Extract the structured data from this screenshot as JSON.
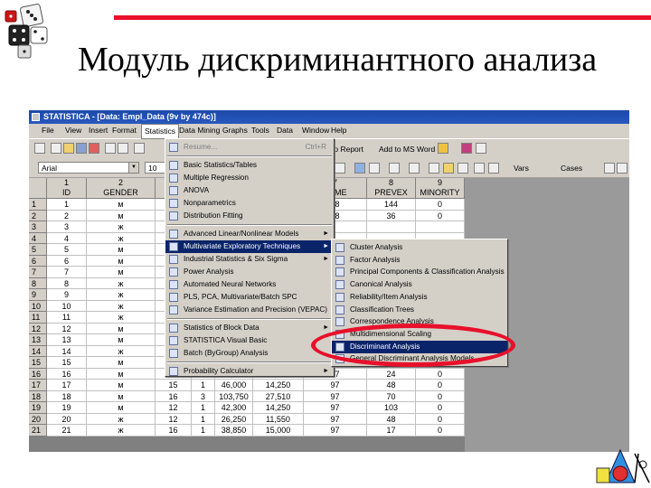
{
  "slide": {
    "title": "Модуль дискриминантного анализа",
    "accent_color": "#e8102a"
  },
  "window": {
    "title": "STATISTICA - [Data: Empl_Data (9v by 474c)]"
  },
  "menubar": {
    "items": [
      "File",
      "View",
      "Insert",
      "Format",
      "Statistics",
      "Data Mining",
      "Graphs",
      "Tools",
      "Data",
      "Window",
      "Help"
    ],
    "active": "Statistics"
  },
  "toolbar": {
    "add_to_report": "to Report",
    "add_to_ms_word": "Add to MS Word",
    "font_name": "Arial",
    "font_size": "10",
    "vars_label": "Vars",
    "cases_label": "Cases"
  },
  "grid": {
    "columns": [
      {
        "num": "1",
        "name": "ID"
      },
      {
        "num": "2",
        "name": "GENDER"
      },
      {
        "num": "",
        "name": "E"
      },
      {
        "num": "",
        "name": ""
      },
      {
        "num": "",
        "name": ""
      },
      {
        "num": "",
        "name": ""
      },
      {
        "num": "7",
        "name": "JTIME"
      },
      {
        "num": "8",
        "name": "PREVEX"
      },
      {
        "num": "9",
        "name": "MINORITY"
      }
    ],
    "rows": [
      {
        "n": "1",
        "cells": [
          "1",
          "м",
          "",
          "",
          "",
          "",
          "98",
          "144",
          "0"
        ]
      },
      {
        "n": "2",
        "cells": [
          "2",
          "м",
          "",
          "",
          "",
          "",
          "98",
          "36",
          "0"
        ]
      },
      {
        "n": "3",
        "cells": [
          "3",
          "ж",
          "",
          "",
          "",
          "",
          "",
          "",
          ""
        ]
      },
      {
        "n": "4",
        "cells": [
          "4",
          "ж",
          "",
          "",
          "",
          "",
          "",
          "",
          ""
        ]
      },
      {
        "n": "5",
        "cells": [
          "5",
          "м",
          "",
          "",
          "",
          "",
          "",
          "",
          ""
        ]
      },
      {
        "n": "6",
        "cells": [
          "6",
          "м",
          "",
          "",
          "",
          "",
          "",
          "",
          ""
        ]
      },
      {
        "n": "7",
        "cells": [
          "7",
          "м",
          "",
          "",
          "",
          "",
          "",
          "",
          ""
        ]
      },
      {
        "n": "8",
        "cells": [
          "8",
          "ж",
          "",
          "",
          "",
          "",
          "",
          "",
          ""
        ]
      },
      {
        "n": "9",
        "cells": [
          "9",
          "ж",
          "",
          "",
          "",
          "",
          "",
          "",
          ""
        ]
      },
      {
        "n": "10",
        "cells": [
          "10",
          "ж",
          "",
          "",
          "",
          "",
          "",
          "",
          ""
        ]
      },
      {
        "n": "11",
        "cells": [
          "11",
          "ж",
          "",
          "",
          "",
          "",
          "",
          "",
          ""
        ]
      },
      {
        "n": "12",
        "cells": [
          "12",
          "м",
          "",
          "",
          "",
          "",
          "",
          "",
          ""
        ]
      },
      {
        "n": "13",
        "cells": [
          "13",
          "м",
          "",
          "",
          "",
          "",
          "",
          "",
          ""
        ]
      },
      {
        "n": "14",
        "cells": [
          "14",
          "ж",
          "",
          "",
          "",
          "",
          "",
          "",
          ""
        ]
      },
      {
        "n": "15",
        "cells": [
          "15",
          "м",
          "15",
          "",
          "",
          "",
          "97",
          "66",
          "0"
        ]
      },
      {
        "n": "16",
        "cells": [
          "16",
          "м",
          "12",
          "1",
          "40,800",
          "15,000",
          "97",
          "24",
          "0"
        ]
      },
      {
        "n": "17",
        "cells": [
          "17",
          "м",
          "15",
          "1",
          "46,000",
          "14,250",
          "97",
          "48",
          "0"
        ]
      },
      {
        "n": "18",
        "cells": [
          "18",
          "м",
          "16",
          "3",
          "103,750",
          "27,510",
          "97",
          "70",
          "0"
        ]
      },
      {
        "n": "19",
        "cells": [
          "19",
          "м",
          "12",
          "1",
          "42,300",
          "14,250",
          "97",
          "103",
          "0"
        ]
      },
      {
        "n": "20",
        "cells": [
          "20",
          "ж",
          "12",
          "1",
          "26,250",
          "11,550",
          "97",
          "48",
          "0"
        ]
      },
      {
        "n": "21",
        "cells": [
          "21",
          "ж",
          "16",
          "1",
          "38,850",
          "15,000",
          "97",
          "17",
          "0"
        ]
      }
    ]
  },
  "statistics_menu": {
    "items": [
      {
        "label": "Resume...",
        "shortcut": "Ctrl+R",
        "disabled": true
      },
      {
        "sep": true
      },
      {
        "label": "Basic Statistics/Tables"
      },
      {
        "label": "Multiple Regression"
      },
      {
        "label": "ANOVA"
      },
      {
        "label": "Nonparametrics"
      },
      {
        "label": "Distribution Fitting"
      },
      {
        "sep": true
      },
      {
        "label": "Advanced Linear/Nonlinear Models",
        "submenu": true
      },
      {
        "label": "Multivariate Exploratory Techniques",
        "submenu": true,
        "highlighted": true
      },
      {
        "label": "Industrial Statistics & Six Sigma",
        "submenu": true
      },
      {
        "label": "Power Analysis"
      },
      {
        "label": "Automated Neural Networks"
      },
      {
        "label": "PLS, PCA, Multivariate/Batch SPC"
      },
      {
        "label": "Variance Estimation and Precision (VEPAC)"
      },
      {
        "sep": true
      },
      {
        "label": "Statistics of Block Data",
        "submenu": true
      },
      {
        "label": "STATISTICA Visual Basic"
      },
      {
        "label": "Batch (ByGroup) Analysis"
      },
      {
        "sep": true
      },
      {
        "label": "Probability Calculator",
        "submenu": true
      }
    ]
  },
  "multivariate_submenu": {
    "items": [
      {
        "label": "Cluster Analysis"
      },
      {
        "label": "Factor Analysis"
      },
      {
        "label": "Principal Components & Classification Analysis"
      },
      {
        "label": "Canonical Analysis"
      },
      {
        "label": "Reliability/Item Analysis"
      },
      {
        "label": "Classification Trees"
      },
      {
        "label": "Correspondence Analysis"
      },
      {
        "label": "Multidimensional Scaling"
      },
      {
        "label": "Discriminant Analysis",
        "highlighted": true
      },
      {
        "label": "General Discriminant Analysis Models"
      }
    ]
  }
}
